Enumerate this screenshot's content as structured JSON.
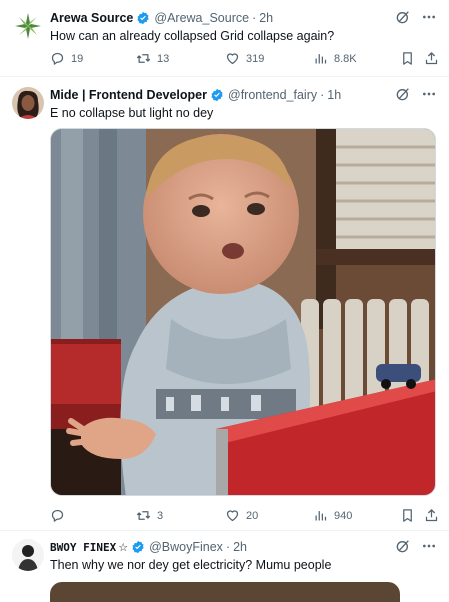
{
  "tweets": [
    {
      "name": "Arewa Source",
      "handle": "@Arewa_Source",
      "time": "2h",
      "text": "How can an already collapsed Grid collapse again?",
      "replies": "19",
      "retweets": "13",
      "likes": "319",
      "views": "8.8K"
    },
    {
      "name": "Mide | Frontend Developer",
      "handle": "@frontend_fairy",
      "time": "1h",
      "text": "E no collapse but light no dey",
      "replies": "",
      "retweets": "3",
      "likes": "20",
      "views": "940"
    },
    {
      "name": "BWOY FINEX",
      "name_suffix": "☆",
      "handle": "@BwoyFinex",
      "time": "2h",
      "text": "Then why we nor dey get electricity? Mumu people"
    }
  ],
  "separator": "·",
  "colors": {
    "verified": "#1d9bf0",
    "icon": "#536471",
    "text": "#0f1419",
    "border": "#eff3f4"
  },
  "icons": [
    "reply-icon",
    "retweet-icon",
    "like-icon",
    "views-icon",
    "bookmark-icon",
    "share-icon",
    "grok-icon",
    "more-icon",
    "verified-icon"
  ]
}
